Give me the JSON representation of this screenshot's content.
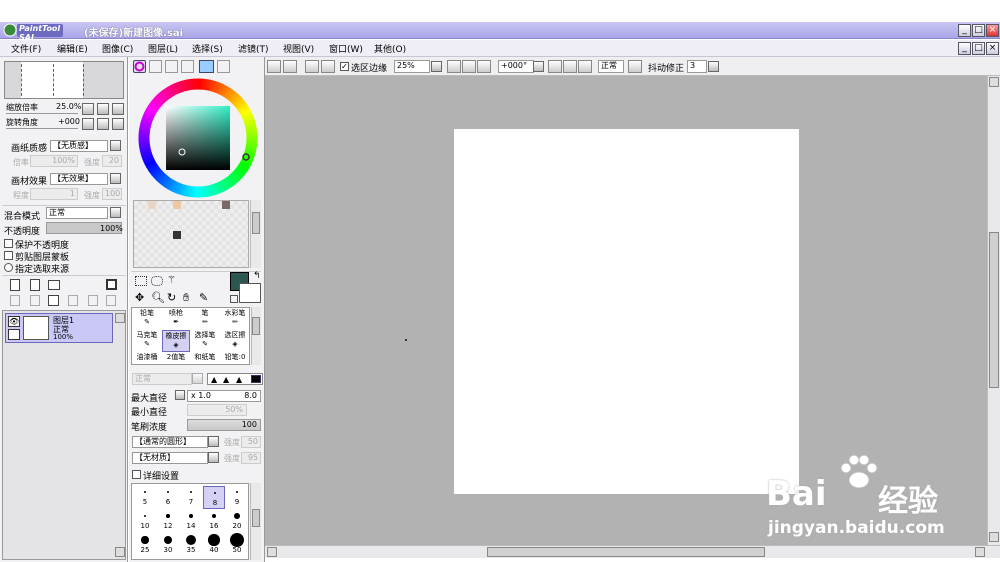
{
  "window": {
    "app_logo": "PaintTool SAI",
    "title": "(未保存)新建图像.sai"
  },
  "menu": [
    "文件(F)",
    "编辑(E)",
    "图像(C)",
    "图层(L)",
    "选择(S)",
    "滤镜(T)",
    "视图(V)",
    "窗口(W)",
    "其他(O)"
  ],
  "navigator": {
    "zoom_label": "缩放倍率",
    "zoom_value": "25.0%",
    "angle_label": "旋转角度",
    "angle_value": "+000"
  },
  "texture": {
    "paper_label": "画纸质感",
    "paper_value": "【无质感】",
    "scale_label": "倍率",
    "scale_value": "100%",
    "strength_label": "强度",
    "strength_value": "20",
    "effect_label": "画材效果",
    "effect_value": "【无效果】",
    "degree_label": "程度",
    "degree_value": "1",
    "strength2_label": "强度",
    "strength2_value": "100"
  },
  "layer_props": {
    "blend_label": "混合模式",
    "blend_value": "正常",
    "opacity_label": "不透明度",
    "opacity_value": "100%",
    "opacity_fill": 1.0,
    "protect_opacity": "保护不透明度",
    "clip_group": "剪贴图层蒙板",
    "selection_source": "指定选取来源"
  },
  "layers": [
    {
      "name": "图层1",
      "mode": "正常",
      "opacity": "100%"
    }
  ],
  "color_swatches": [
    "#e9d6c6",
    "#f0c8a0",
    "#7a6a66",
    "#333333"
  ],
  "colors": {
    "primary": "#2c5652",
    "secondary": "#ffffff",
    "titlebar": "#b7b3ee",
    "canvas_bg": "#b2b2b2"
  },
  "tools": [
    "铅笔",
    "喷枪",
    "笔",
    "水彩笔",
    "马克笔",
    "橡皮擦",
    "选择笔",
    "选区擦",
    "油漆桶",
    "2值笔",
    "和纸笔",
    "铅笔:0"
  ],
  "brush": {
    "mode_value": "正常",
    "max_size_label": "最大直径",
    "max_size_mult": "x 1.0",
    "max_size_value": "8.0",
    "min_size_label": "最小直径",
    "min_size_value": "50%",
    "density_label": "笔刷浓度",
    "density_value": "100",
    "shape_value": "【通常的圆形】",
    "shape_strength_label": "强度",
    "shape_strength_value": "50",
    "texture_value": "【无材质】",
    "texture_strength_label": "强度",
    "texture_strength_value": "95",
    "detail_label": "详细设置",
    "sizes_row1": [
      "5",
      "6",
      "7",
      "8",
      "9"
    ],
    "sizes_row2": [
      "10",
      "12",
      "14",
      "16",
      "20"
    ],
    "sizes_row3": [
      "25",
      "30",
      "35",
      "40",
      "50"
    ]
  },
  "toolbar": {
    "selection_edge_label": "选区边缘",
    "zoom_value": "25%",
    "angle_value": "+000°",
    "mode_value": "正常",
    "stabilizer_label": "抖动修正",
    "stabilizer_value": "3"
  },
  "watermark": {
    "brand": "Bai",
    "brand2": "经验",
    "url": "jingyan.baidu.com"
  }
}
